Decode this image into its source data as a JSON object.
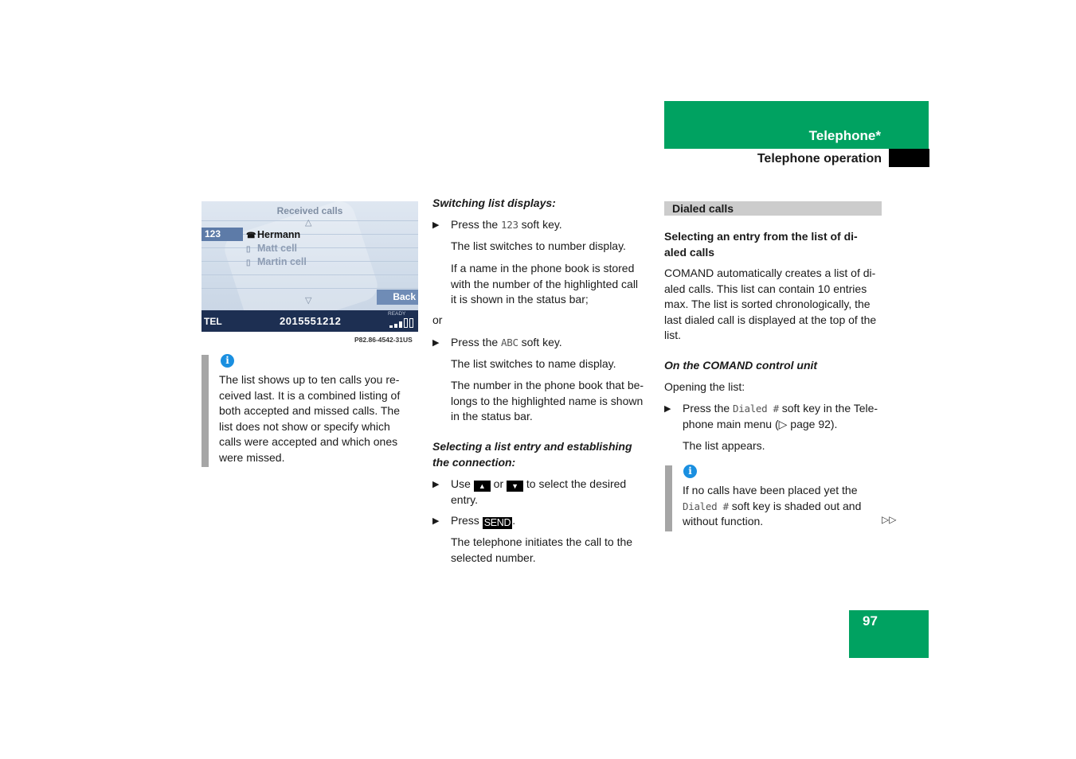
{
  "header": {
    "chapter": "Telephone*",
    "section": "Telephone operation"
  },
  "screen": {
    "title": "Received calls",
    "softkey_left": "123",
    "items": [
      {
        "icon": "phone-book-icon",
        "label": "Hermann",
        "highlighted": true
      },
      {
        "icon": "mobile-phone-icon",
        "label": "Matt cell",
        "highlighted": false
      },
      {
        "icon": "mobile-phone-icon",
        "label": "Martin cell",
        "highlighted": false
      }
    ],
    "back_label": "Back",
    "status_label": "TEL",
    "status_number": "2015551212",
    "status_ready": "READY",
    "signal_strength": "3 of 5 bars",
    "caption": "P82.86-4542-31US"
  },
  "note_left": {
    "text_lines": [
      "The list shows up to ten calls you re-",
      "ceived last. It is a combined listing of",
      "both accepted and missed calls. The",
      "list does not show or specify which",
      "calls were accepted and which ones",
      "were missed."
    ]
  },
  "col2": {
    "heading1": "Switching list displays:",
    "step1_pre": "Press the ",
    "step1_key": "123",
    "step1_post": " soft key.",
    "p1": "The list switches to number display.",
    "p2_lines": [
      "If a name in the phone book is stored",
      "with the number of the highlighted call",
      "it is shown in the status bar;"
    ],
    "or": "or",
    "step2_pre": "Press the ",
    "step2_key": "ABC",
    "step2_post": " soft key.",
    "p3": "The list switches to name display.",
    "p4_lines": [
      "The number in the phone book that be-",
      "longs to the highlighted name is shown",
      "in the status bar."
    ],
    "heading2_lines": [
      "Selecting a list entry and establishing",
      "the connection:"
    ],
    "step3_pre": "Use ",
    "step3_up": "▲",
    "step3_mid": " or ",
    "step3_down": "▼",
    "step3_post": " to select the desired",
    "step3_line2": "entry.",
    "step4_pre": "Press ",
    "step4_key": "SEND",
    "step4_post": ".",
    "p5_lines": [
      "The telephone initiates the call to the",
      "selected number."
    ]
  },
  "col3": {
    "bar_title": "Dialed calls",
    "heading_lines": [
      "Selecting an entry from the list of di-",
      "aled calls"
    ],
    "body_lines": [
      "COMAND automatically creates a list of di-",
      "aled calls. This list can contain 10 entries",
      "max. The list is sorted chronologically, the",
      "last dialed call is displayed at the top of the",
      "list."
    ],
    "subheading": "On the COMAND control unit",
    "opening": "Opening the list:",
    "step_pre": "Press the ",
    "step_key": "Dialed #",
    "step_post": " soft key in the Tele-",
    "step_line2": "phone main menu (▷ page 92).",
    "result": "The list appears.",
    "note_line1": "If no calls have been placed yet the",
    "note_key": "Dialed #",
    "note_line2_post": " soft key is shaded out and",
    "note_line3": "without function.",
    "continue_marker": "▷▷"
  },
  "page_number": "97",
  "colors": {
    "brand_green": "#00a261",
    "info_blue": "#1a8fe0",
    "note_bar_gray": "#a6a6a6",
    "section_bar_gray": "#cccccc"
  }
}
